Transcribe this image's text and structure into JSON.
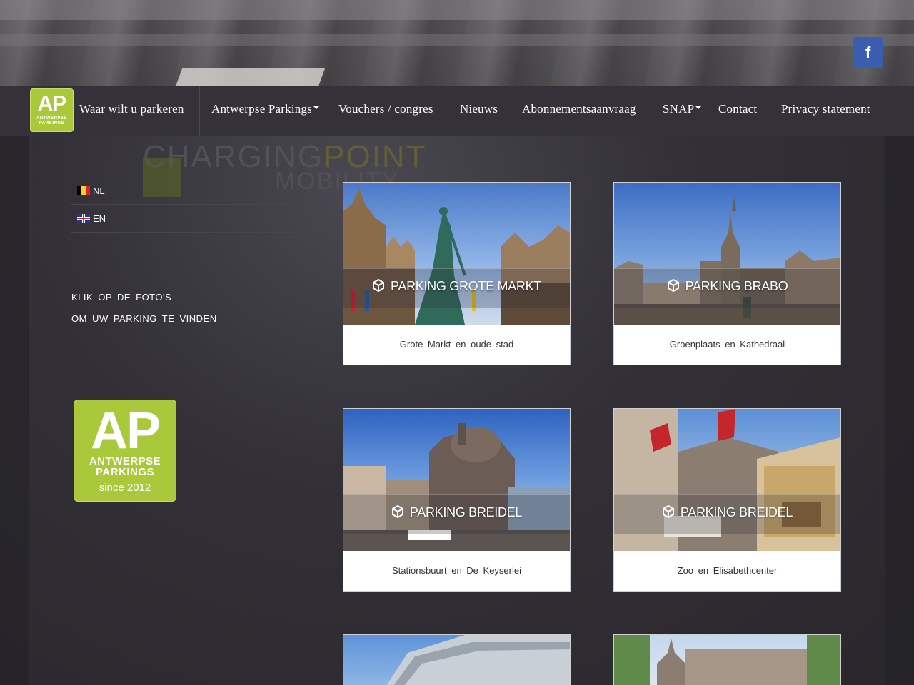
{
  "social": {
    "facebook_label": "f"
  },
  "nav": {
    "logo_big": "AP",
    "logo_small_1": "ANTWERPSE",
    "logo_small_2": "PARKINGS",
    "items": [
      {
        "label": "Waar wilt u parkeren",
        "dropdown": false
      },
      {
        "label": "Antwerpse Parkings",
        "dropdown": true
      },
      {
        "label": "Vouchers / congres",
        "dropdown": false
      },
      {
        "label": "Nieuws",
        "dropdown": false
      },
      {
        "label": "Abonnementsaanvraag",
        "dropdown": false
      },
      {
        "label": "SNAP",
        "dropdown": true
      },
      {
        "label": "Contact",
        "dropdown": false
      },
      {
        "label": "Privacy statement",
        "dropdown": false
      }
    ]
  },
  "background": {
    "sign_line1_a": "CHARGING",
    "sign_line1_b": "POINT",
    "sign_line2": "MOBILITY"
  },
  "sidebar": {
    "languages": [
      {
        "code": "NL",
        "flag": "belgium-flag"
      },
      {
        "code": "EN",
        "flag": "uk-flag"
      }
    ],
    "instruction_line1": "KLIK OP DE FOTO'S",
    "instruction_line2": "OM UW PARKING TE VINDEN",
    "logo": {
      "big": "AP",
      "line1": "ANTWERPSE",
      "line2": "PARKINGS",
      "since": "since 2012"
    }
  },
  "cards": [
    {
      "title": "PARKING GROTE MARKT",
      "caption": "Grote Markt en oude stad"
    },
    {
      "title": "PARKING BRABO",
      "caption": "Groenplaats en Kathedraal"
    },
    {
      "title": "PARKING BREIDEL",
      "caption": "Stationsbuurt en De Keyserlei"
    },
    {
      "title": "PARKING BREIDEL",
      "caption": "Zoo en Elisabethcenter"
    }
  ],
  "colors": {
    "brand_green": "#a9c93a",
    "nav_bg": "#363238",
    "facebook_blue": "#3b5db0"
  }
}
